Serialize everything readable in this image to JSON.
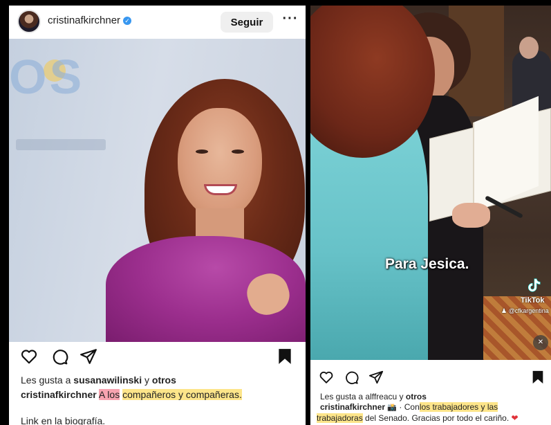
{
  "left_post": {
    "username": "cristinafkirchner",
    "follow_label": "Seguir",
    "more_label": "···",
    "image_logo_text": "OS",
    "likes_prefix": "Les gusta a ",
    "likes_user": "susanawilinski",
    "likes_mid": " y ",
    "likes_others": "otros",
    "caption_user": "cristinafkirchner",
    "caption_part_pink": "A los",
    "caption_part_yellow": "compañeros y compañeras.",
    "bio_link": "Link en la biografía."
  },
  "right_post": {
    "video_overlay_text": "Para Jesica.",
    "tiktok_label": "TikTok",
    "tiktok_handle": "@cfkargentina",
    "likes_prefix": "Les gusta a ",
    "likes_user": "alffreacu",
    "likes_mid": " y ",
    "likes_others": "otros",
    "caption_user": "cristinafkirchner",
    "caption_sep": " · Con",
    "caption_hl_1": "los trabajadores y las",
    "caption_hl_2": "trabajadoras",
    "caption_rest": " del Senado. Gracias por todo el cariño."
  },
  "icons": {
    "like": "heart-icon",
    "comment": "comment-icon",
    "share": "send-icon",
    "save": "bookmark-icon",
    "mute": "mute-icon",
    "verified": "verified-badge-icon"
  },
  "colors": {
    "highlight_pink": "#f7a3b0",
    "highlight_yellow": "#fde58a",
    "verified_blue": "#3897f0",
    "blouse_magenta": "#9b2e8d"
  }
}
